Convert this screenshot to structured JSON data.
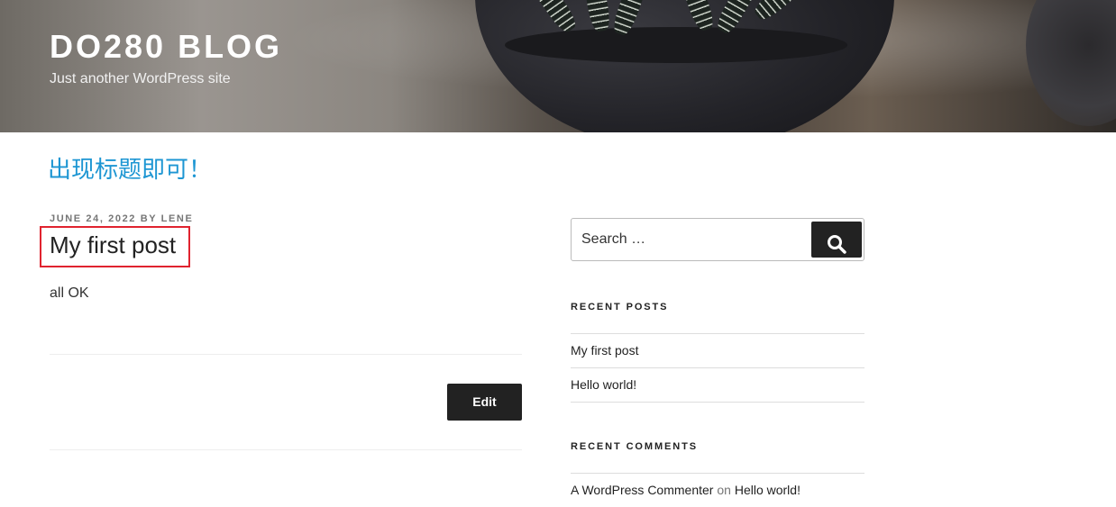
{
  "header": {
    "site_title": "DO280 BLOG",
    "site_description": "Just another WordPress site"
  },
  "page": {
    "heading": "出现标题即可！"
  },
  "post": {
    "date": "JUNE 24, 2022",
    "by": "BY",
    "author": "LENE",
    "title": "My first post",
    "body": "all OK",
    "edit_label": "Edit"
  },
  "sidebar": {
    "search": {
      "placeholder": "Search …"
    },
    "recent_posts": {
      "title": "RECENT POSTS",
      "items": [
        {
          "label": "My first post"
        },
        {
          "label": "Hello world!"
        }
      ]
    },
    "recent_comments": {
      "title": "RECENT COMMENTS",
      "items": [
        {
          "author": "A WordPress Commenter",
          "on": "on",
          "post": "Hello world!"
        }
      ]
    }
  },
  "colors": {
    "accent_link": "#1d96d3",
    "button_dark": "#222222",
    "highlight_box": "#e0232f"
  },
  "icons": {
    "search_button": "search-icon"
  }
}
